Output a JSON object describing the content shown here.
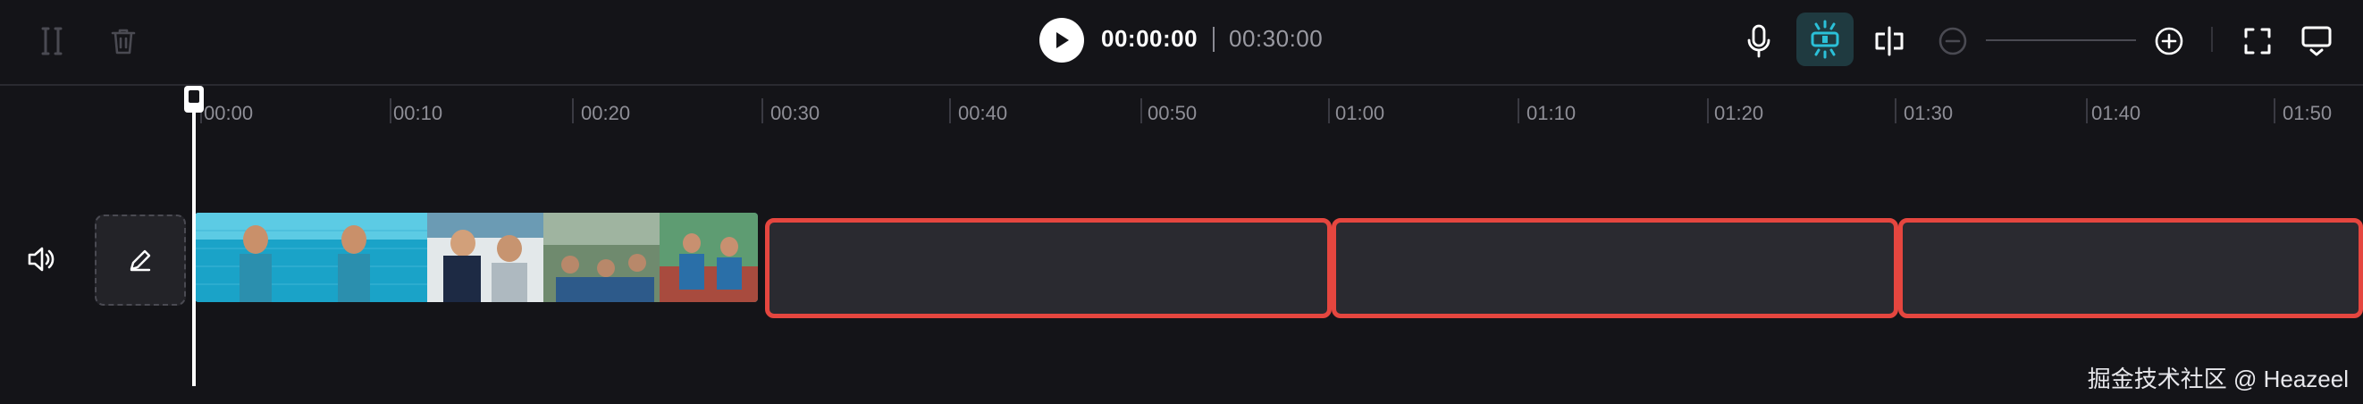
{
  "toolbar": {
    "split_icon": "split-icon",
    "delete_icon": "trash-icon",
    "play_icon": "play-icon",
    "current_time": "00:00:00",
    "total_time": "00:30:00",
    "record_icon": "microphone-icon",
    "smart_icon": "smart-cut-icon",
    "snap_icon": "snap-split-icon",
    "zoom_out_icon": "zoom-out-icon",
    "zoom_in_icon": "zoom-in-icon",
    "fullscreen_icon": "fullscreen-icon",
    "preview_icon": "preview-icon"
  },
  "ruler": {
    "labels": [
      "00:00",
      "00:10",
      "00:20",
      "00:30",
      "00:40",
      "00:50",
      "01:00",
      "01:10",
      "01:20",
      "01:30",
      "01:40",
      "01:50"
    ]
  },
  "track": {
    "mute_icon": "speaker-icon",
    "edit_icon": "pencil-icon"
  },
  "colors": {
    "background": "#141418",
    "accent": "#2bc0d8",
    "highlight_border": "#e5463f"
  },
  "watermark": "掘金技术社区 @ Heazeel"
}
